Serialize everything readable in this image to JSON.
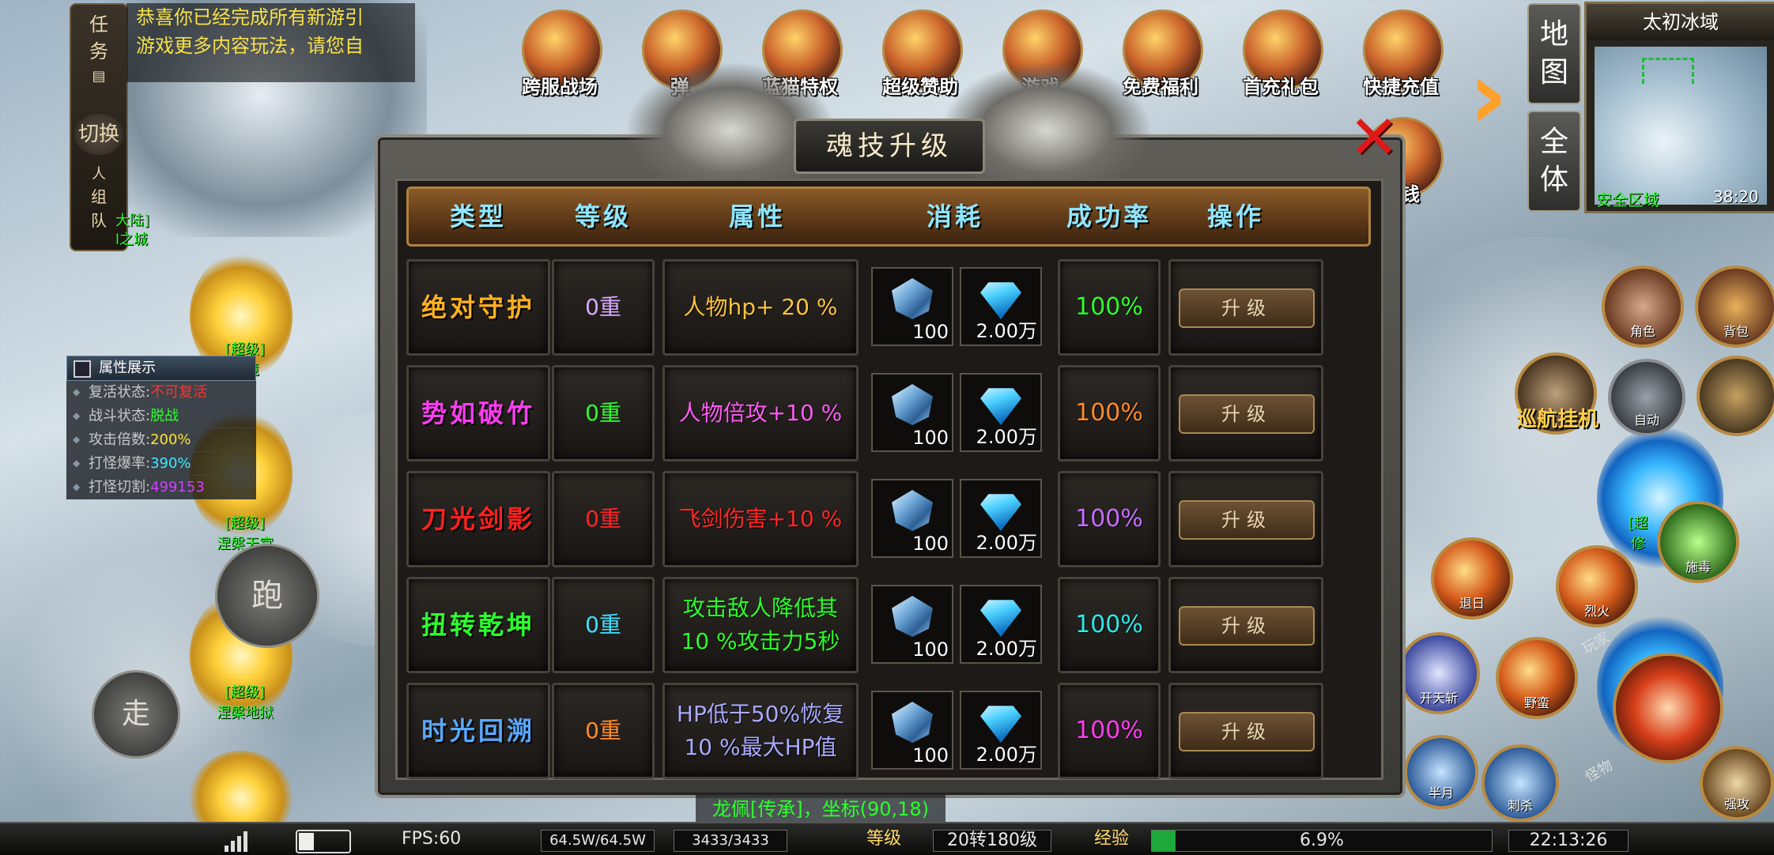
{
  "quest": {
    "tab_top": "任\n务",
    "switch": "切换",
    "team": "组\n队",
    "text_line1": "恭喜你已经完成所有新游引",
    "text_line2": "游戏更多内容玩法，请您自",
    "map_tag1": "大陆]",
    "map_tag2": "l之城"
  },
  "attributes": {
    "title": "属性展示",
    "rows": [
      {
        "label": "复活状态:",
        "value": "不可复活",
        "color": "#ff3030"
      },
      {
        "label": "战斗状态:",
        "value": "脱战",
        "color": "#2dff2d"
      },
      {
        "label": "攻击倍数:",
        "value": "200%",
        "color": "#ffe23a"
      },
      {
        "label": "打怪爆率:",
        "value": "390%",
        "color": "#40e8ff"
      },
      {
        "label": "打怪切割:",
        "value": "499153",
        "color": "#d040ff"
      }
    ]
  },
  "world_tags": {
    "t1": "[超级]",
    "t1b": "地境",
    "t2": "[超级]",
    "t2b": "涅槃天宫",
    "t3": "[超级]",
    "t3b": "涅槃地狱",
    "t4": "[超",
    "t4b": "修"
  },
  "controls": {
    "run": "跑",
    "walk": "走"
  },
  "top_icons": [
    {
      "label": "跨服战场"
    },
    {
      "label": "弹"
    },
    {
      "label": "蓝猫特权"
    },
    {
      "label": "超级赞助"
    },
    {
      "label": "游戏"
    },
    {
      "label": "免费福利"
    },
    {
      "label": "首充礼包"
    },
    {
      "label": "快捷充值"
    },
    {
      "label": "省钱"
    }
  ],
  "map": {
    "btn_map": "地\n图",
    "btn_all": "全\n体",
    "title": "太初冰域",
    "safe": "安全区域",
    "time": "38:20"
  },
  "right_buttons": {
    "role": "角色",
    "bag": "背包",
    "patrol": "巡航挂机",
    "auto": "自动",
    "skills": [
      "退日",
      "烈火",
      "施毒",
      "开天斩",
      "野蛮",
      "半月",
      "刺杀",
      "强攻"
    ],
    "side1": "玩家",
    "side2": "怪物"
  },
  "dialog": {
    "title": "魂技升级",
    "headers": [
      "类型",
      "等级",
      "属性",
      "消耗",
      "成功率",
      "操作"
    ],
    "rows": [
      {
        "type": "绝对守护",
        "type_color": "#ffb01e",
        "level": "0重",
        "level_color": "#d8a8ff",
        "attr1": "人物hp+ 20 %",
        "attr2": "",
        "attr_color": "#ffc438",
        "cost1": "100",
        "cost2": "2.00万",
        "rate": "100%",
        "rate_color": "#2dff2d",
        "action": "升级"
      },
      {
        "type": "势如破竹",
        "type_color": "#ff3cf0",
        "level": "0重",
        "level_color": "#2dff2d",
        "attr1": "人物倍攻+10 %",
        "attr2": "",
        "attr_color": "#ff5cf2",
        "cost1": "100",
        "cost2": "2.00万",
        "rate": "100%",
        "rate_color": "#ff8a2a",
        "action": "升级"
      },
      {
        "type": "刀光剑影",
        "type_color": "#ff2020",
        "level": "0重",
        "level_color": "#ff2424",
        "attr1": "飞剑伤害+10 %",
        "attr2": "",
        "attr_color": "#ff2828",
        "cost1": "100",
        "cost2": "2.00万",
        "rate": "100%",
        "rate_color": "#c76cff",
        "action": "升级"
      },
      {
        "type": "扭转乾坤",
        "type_color": "#2dff2d",
        "level": "0重",
        "level_color": "#40e0ff",
        "attr1": "攻击敌人降低其",
        "attr2": "10 %攻击力5秒",
        "attr_color": "#2dff2d",
        "cost1": "100",
        "cost2": "2.00万",
        "rate": "100%",
        "rate_color": "#2de8e8",
        "action": "升级"
      },
      {
        "type": "时光回溯",
        "type_color": "#58a8ff",
        "level": "0重",
        "level_color": "#ff8a2a",
        "attr1": "HP低于50%恢复",
        "attr2": "10 %最大HP值",
        "attr_color": "#a9a9ff",
        "cost1": "100",
        "cost2": "2.00万",
        "rate": "100%",
        "rate_color": "#ff3cf0",
        "action": "升级"
      }
    ]
  },
  "coord_text": "龙佩[传承]，坐标(90,18)",
  "status_bar": {
    "fps": "FPS:60",
    "hp": "64.5W/64.5W",
    "mp": "3433/3433",
    "level_label": "等级",
    "level": "20转180级",
    "exp_label": "经验",
    "exp": "6.9%",
    "exp_fraction": 0.069,
    "battery_fraction": 0.3,
    "clock": "22:13:26"
  }
}
